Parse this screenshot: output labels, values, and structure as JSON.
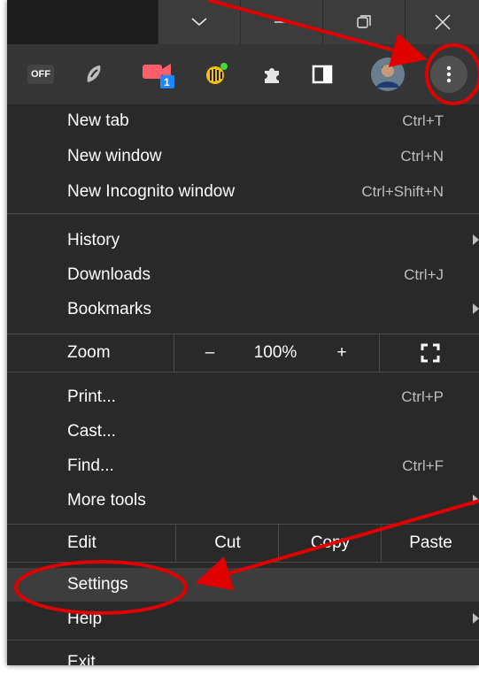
{
  "titlebar": {
    "buttons": [
      "chevron-down",
      "minimize",
      "maximize",
      "close"
    ]
  },
  "toolbar": {
    "extensions": [
      {
        "name": "off-extension",
        "text": "OFF"
      },
      {
        "name": "s-extension"
      },
      {
        "name": "screencast-extension",
        "badge": "1"
      },
      {
        "name": "keeper-extension"
      },
      {
        "name": "extensions-puzzle"
      },
      {
        "name": "side-panel"
      },
      {
        "name": "profile-avatar"
      },
      {
        "name": "menu-kebab"
      }
    ]
  },
  "menu": {
    "new_tab": {
      "label": "New tab",
      "shortcut": "Ctrl+T"
    },
    "new_window": {
      "label": "New window",
      "shortcut": "Ctrl+N"
    },
    "new_incognito": {
      "label": "New Incognito window",
      "shortcut": "Ctrl+Shift+N"
    },
    "history": {
      "label": "History"
    },
    "downloads": {
      "label": "Downloads",
      "shortcut": "Ctrl+J"
    },
    "bookmarks": {
      "label": "Bookmarks"
    },
    "zoom": {
      "label": "Zoom",
      "minus": "–",
      "level": "100%",
      "plus": "+"
    },
    "print": {
      "label": "Print...",
      "shortcut": "Ctrl+P"
    },
    "cast": {
      "label": "Cast..."
    },
    "find": {
      "label": "Find...",
      "shortcut": "Ctrl+F"
    },
    "more_tools": {
      "label": "More tools"
    },
    "edit": {
      "label": "Edit",
      "cut": "Cut",
      "copy": "Copy",
      "paste": "Paste"
    },
    "settings": {
      "label": "Settings"
    },
    "help": {
      "label": "Help"
    },
    "exit": {
      "label": "Exit"
    }
  },
  "colors": {
    "menu_bg": "#292929",
    "toolbar_bg": "#353535",
    "annotation": "#e00000"
  }
}
